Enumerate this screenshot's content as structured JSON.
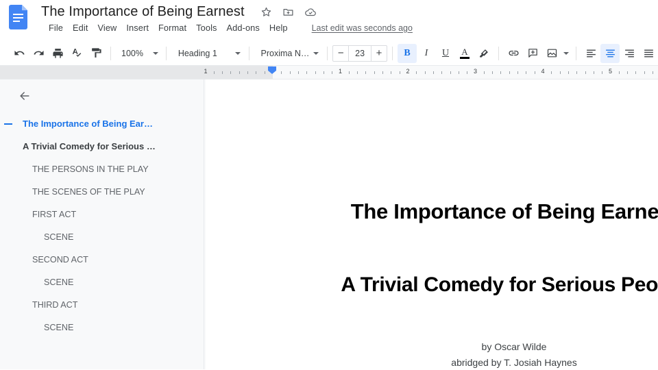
{
  "app": {
    "name": "Google Docs",
    "logo_icon": "google-docs-icon",
    "accent_color": "#1a73e8",
    "logo_color": "#4285f4"
  },
  "header": {
    "doc_title": "The Importance of Being Earnest",
    "title_icons": [
      {
        "name": "star-icon",
        "label": "Star"
      },
      {
        "name": "move-to-folder-icon",
        "label": "Move"
      },
      {
        "name": "cloud-saved-icon",
        "label": "See document status"
      }
    ],
    "menu_items": [
      {
        "label": "File"
      },
      {
        "label": "Edit"
      },
      {
        "label": "View"
      },
      {
        "label": "Insert"
      },
      {
        "label": "Format"
      },
      {
        "label": "Tools"
      },
      {
        "label": "Add-ons"
      },
      {
        "label": "Help"
      }
    ],
    "last_edit": "Last edit was seconds ago"
  },
  "toolbar": {
    "undo_icon": "undo-icon",
    "redo_icon": "redo-icon",
    "print_icon": "print-icon",
    "spellcheck_icon": "spellcheck-icon",
    "paint_format_icon": "paint-format-icon",
    "zoom_value": "100%",
    "paragraph_style": "Heading 1",
    "font_family": "Proxima N…",
    "font_size": "23",
    "decrease_label": "−",
    "increase_label": "+",
    "bold_label": "B",
    "italic_label": "I",
    "underline_label": "U",
    "text_color_label": "A",
    "text_color_value": "#000000",
    "highlight_icon": "highlight-color-icon",
    "link_icon": "insert-link-icon",
    "comment_icon": "add-comment-icon",
    "image_icon": "insert-image-icon",
    "align_left_icon": "align-left-icon",
    "align_center_icon": "align-center-icon",
    "align_right_icon": "align-right-icon",
    "align_justify_icon": "align-justify-icon",
    "active_states": {
      "bold": true,
      "align": "center"
    }
  },
  "ruler": {
    "tick_numbers": [
      "1",
      "2",
      "3",
      "4",
      "5"
    ],
    "indent_marker": "left-indent-marker"
  },
  "outline": {
    "back_icon": "back-arrow-icon",
    "items": [
      {
        "label": "The Importance of Being Ear…",
        "level": 0,
        "active": true
      },
      {
        "label": "A Trivial Comedy for Serious …",
        "level": 1,
        "active": false
      },
      {
        "label": "THE PERSONS IN THE PLAY",
        "level": 2,
        "active": false
      },
      {
        "label": "THE SCENES OF THE PLAY",
        "level": 2,
        "active": false
      },
      {
        "label": "FIRST ACT",
        "level": 2,
        "active": false
      },
      {
        "label": "SCENE",
        "level": 3,
        "active": false
      },
      {
        "label": "SECOND ACT",
        "level": 2,
        "active": false
      },
      {
        "label": "SCENE",
        "level": 3,
        "active": false
      },
      {
        "label": "THIRD ACT",
        "level": 2,
        "active": false
      },
      {
        "label": "SCENE",
        "level": 3,
        "active": false
      }
    ]
  },
  "document": {
    "heading_1": "The Importance of Being Earnest",
    "heading_2": "A Trivial Comedy for Serious People",
    "byline_author": "by Oscar Wilde",
    "byline_abridger": "abridged by T. Josiah Haynes"
  }
}
